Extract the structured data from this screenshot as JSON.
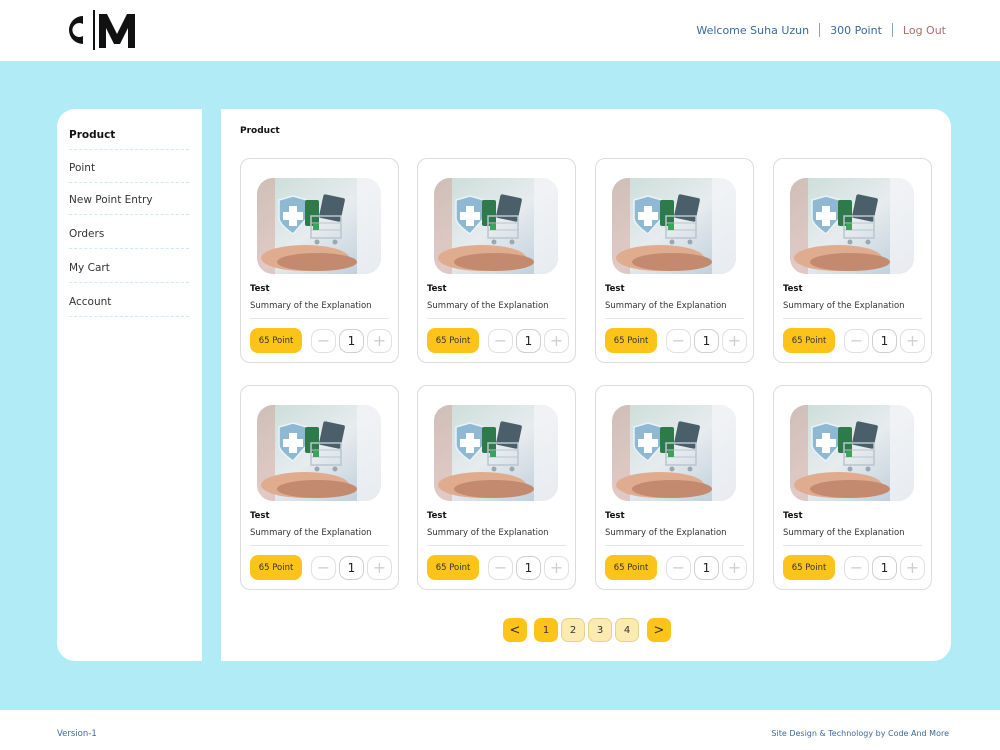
{
  "header": {
    "logo_text": "CM",
    "welcome": "Welcome Suha Uzun",
    "points": "300 Point",
    "logout": "Log Out"
  },
  "sidebar": {
    "items": [
      {
        "label": "Product",
        "active": true
      },
      {
        "label": "Point"
      },
      {
        "label": "New Point Entry"
      },
      {
        "label": "Orders"
      },
      {
        "label": "My Cart"
      },
      {
        "label": "Account"
      }
    ]
  },
  "main": {
    "title": "Product",
    "products": [
      {
        "name": "Test",
        "summary": "Summary of the Explanation",
        "price": "65 Point",
        "qty": "1"
      },
      {
        "name": "Test",
        "summary": "Summary of the Explanation",
        "price": "65 Point",
        "qty": "1"
      },
      {
        "name": "Test",
        "summary": "Summary of the Explanation",
        "price": "65 Point",
        "qty": "1"
      },
      {
        "name": "Test",
        "summary": "Summary of the Explanation",
        "price": "65 Point",
        "qty": "1"
      },
      {
        "name": "Test",
        "summary": "Summary of the Explanation",
        "price": "65 Point",
        "qty": "1"
      },
      {
        "name": "Test",
        "summary": "Summary of the Explanation",
        "price": "65 Point",
        "qty": "1"
      },
      {
        "name": "Test",
        "summary": "Summary of the Explanation",
        "price": "65 Point",
        "qty": "1"
      },
      {
        "name": "Test",
        "summary": "Summary of the Explanation",
        "price": "65 Point",
        "qty": "1"
      }
    ],
    "pagination": {
      "prev": "<",
      "pages": [
        "1",
        "2",
        "3",
        "4"
      ],
      "current": "1",
      "next": ">"
    }
  },
  "footer": {
    "version": "Version-1",
    "credit": "Site Design & Technology by Code And More"
  },
  "colors": {
    "accent": "#fcc419",
    "background_band": "#b1ebf5",
    "link": "#3a6a9a",
    "logout": "#b36a6a"
  },
  "icons": [
    "minus-icon",
    "plus-icon",
    "chevron-left-icon",
    "chevron-right-icon"
  ]
}
